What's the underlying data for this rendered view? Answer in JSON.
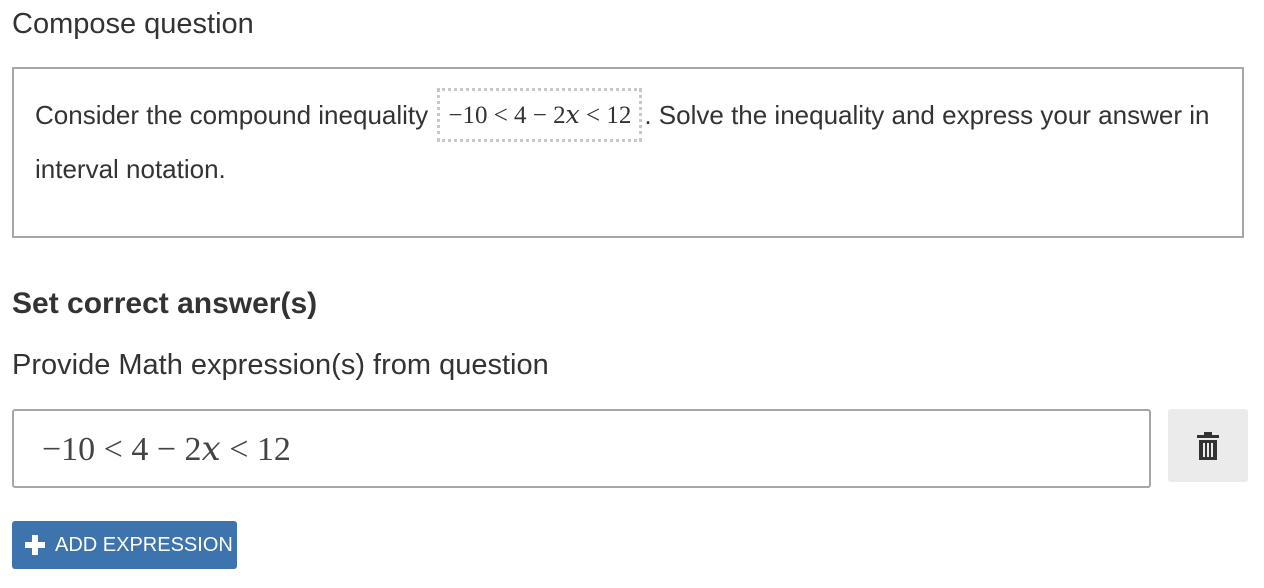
{
  "compose": {
    "label": "Compose question",
    "text_before": "Consider the compound inequality ",
    "math": "−10 < 4 − 2𝑥 < 12",
    "text_after": ". Solve the inequality and express your answer in interval notation."
  },
  "answers": {
    "title": "Set correct answer(s)",
    "subtitle": "Provide Math expression(s) from question",
    "expression_value": "−10 < 4 − 2𝑥 < 12",
    "delete_icon": "trash-icon",
    "add_label": "ADD EXPRESSION",
    "add_icon": "plus-icon",
    "accent_color": "#3d74ad"
  }
}
